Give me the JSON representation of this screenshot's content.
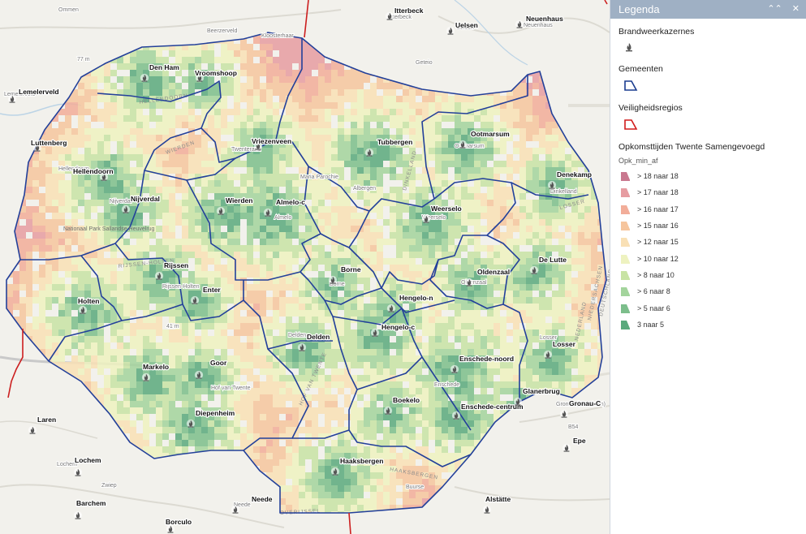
{
  "legend": {
    "title": "Legenda",
    "collapse_icon": "double-chevron-up-icon",
    "close_icon": "close-icon",
    "sections": {
      "stations": {
        "label": "Brandweerkazernes",
        "icon": "fire-station-icon"
      },
      "municipalities": {
        "label": "Gemeenten",
        "color": "#1a3c8f"
      },
      "safety_regions": {
        "label": "Veiligheidsregios",
        "color": "#d11b1b"
      },
      "response": {
        "label": "Opkomsttijden Twente Samengevoegd",
        "field": "Opk_min_af",
        "classes": [
          {
            "label": "> 18 naar 18",
            "color": "#c9788f"
          },
          {
            "label": "> 17 naar 18",
            "color": "#e69ca1"
          },
          {
            "label": "> 16 naar 17",
            "color": "#f2ad99"
          },
          {
            "label": "> 15 naar 16",
            "color": "#f6c59d"
          },
          {
            "label": "> 12 naar 15",
            "color": "#f9e0b5"
          },
          {
            "label": "> 10 naar 12",
            "color": "#eef2c0"
          },
          {
            "label": "> 8 naar 10",
            "color": "#c8e3a4"
          },
          {
            "label": "> 6 naar 8",
            "color": "#a3d49c"
          },
          {
            "label": "> 5 naar 6",
            "color": "#7cbe8b"
          },
          {
            "label": "3 naar 5",
            "color": "#5aa97d"
          }
        ]
      }
    }
  },
  "map": {
    "stations": [
      {
        "name": "Den Ham"
      },
      {
        "name": "Vroomshoop"
      },
      {
        "name": "Hellendoorn"
      },
      {
        "name": "Nijverdal"
      },
      {
        "name": "Vriezenveen"
      },
      {
        "name": "Wierden"
      },
      {
        "name": "Almelo-c"
      },
      {
        "name": "Tubbergen"
      },
      {
        "name": "Ootmarsum"
      },
      {
        "name": "Denekamp"
      },
      {
        "name": "Weerselo"
      },
      {
        "name": "Oldenzaal"
      },
      {
        "name": "De Lutte"
      },
      {
        "name": "Borne"
      },
      {
        "name": "Rijssen"
      },
      {
        "name": "Enter"
      },
      {
        "name": "Holten"
      },
      {
        "name": "Hengelo-n"
      },
      {
        "name": "Hengelo-c"
      },
      {
        "name": "Delden"
      },
      {
        "name": "Enschede-noord"
      },
      {
        "name": "Losser"
      },
      {
        "name": "Markelo"
      },
      {
        "name": "Goor"
      },
      {
        "name": "Diepenheim"
      },
      {
        "name": "Boekelo"
      },
      {
        "name": "Enschede-centrum"
      },
      {
        "name": "Glanerbrug"
      },
      {
        "name": "Gronau-C"
      },
      {
        "name": "Haaksbergen"
      },
      {
        "name": "Lemelerveld"
      },
      {
        "name": "Luttenberg"
      },
      {
        "name": "Laren"
      },
      {
        "name": "Lochem"
      },
      {
        "name": "Barchem"
      },
      {
        "name": "Borculo"
      },
      {
        "name": "Neede"
      },
      {
        "name": "Alstätte"
      },
      {
        "name": "Epe"
      },
      {
        "name": "Itterbeck"
      },
      {
        "name": "Uelsen"
      },
      {
        "name": "Neuenhaus"
      }
    ],
    "place_labels": [
      "Ommen",
      "Beerzerveld",
      "Kloosterhaar",
      "Geteio",
      "Itterbeck",
      "Uelsen",
      "Neuenhaus",
      "Twenterand",
      "Maria Parochie",
      "Albergen",
      "Nationaal Park Sallandse Heuvelrug",
      "Hof van Twente",
      "Enschede",
      "Buurse",
      "Gronau (Westfalen)",
      "Losser",
      "Lochem",
      "Zwiep",
      "Neede",
      "Nijverdal",
      "Hellendoorn",
      "Almelo",
      "Borne",
      "Oldenzaal",
      "Dinkelland",
      "Rijssen-Holten",
      "Lemelerveld",
      "Ootmarsum",
      "Weerselo",
      "Delden"
    ],
    "elevation_labels": [
      "77 m",
      "41 m"
    ],
    "road_labels": [
      "B54"
    ],
    "region_labels": [
      "WIERDEN",
      "RIJSSEN-HOLTEN",
      "HELLENDOORN",
      "HAAKSBERGEN",
      "OVERIJSSEL",
      "DINKELLAND",
      "LOSSER",
      "HOF VAN TWENTE",
      "NIEDERSACHSEN",
      "DEUTSCHLAND",
      "NEDERLAND"
    ]
  }
}
